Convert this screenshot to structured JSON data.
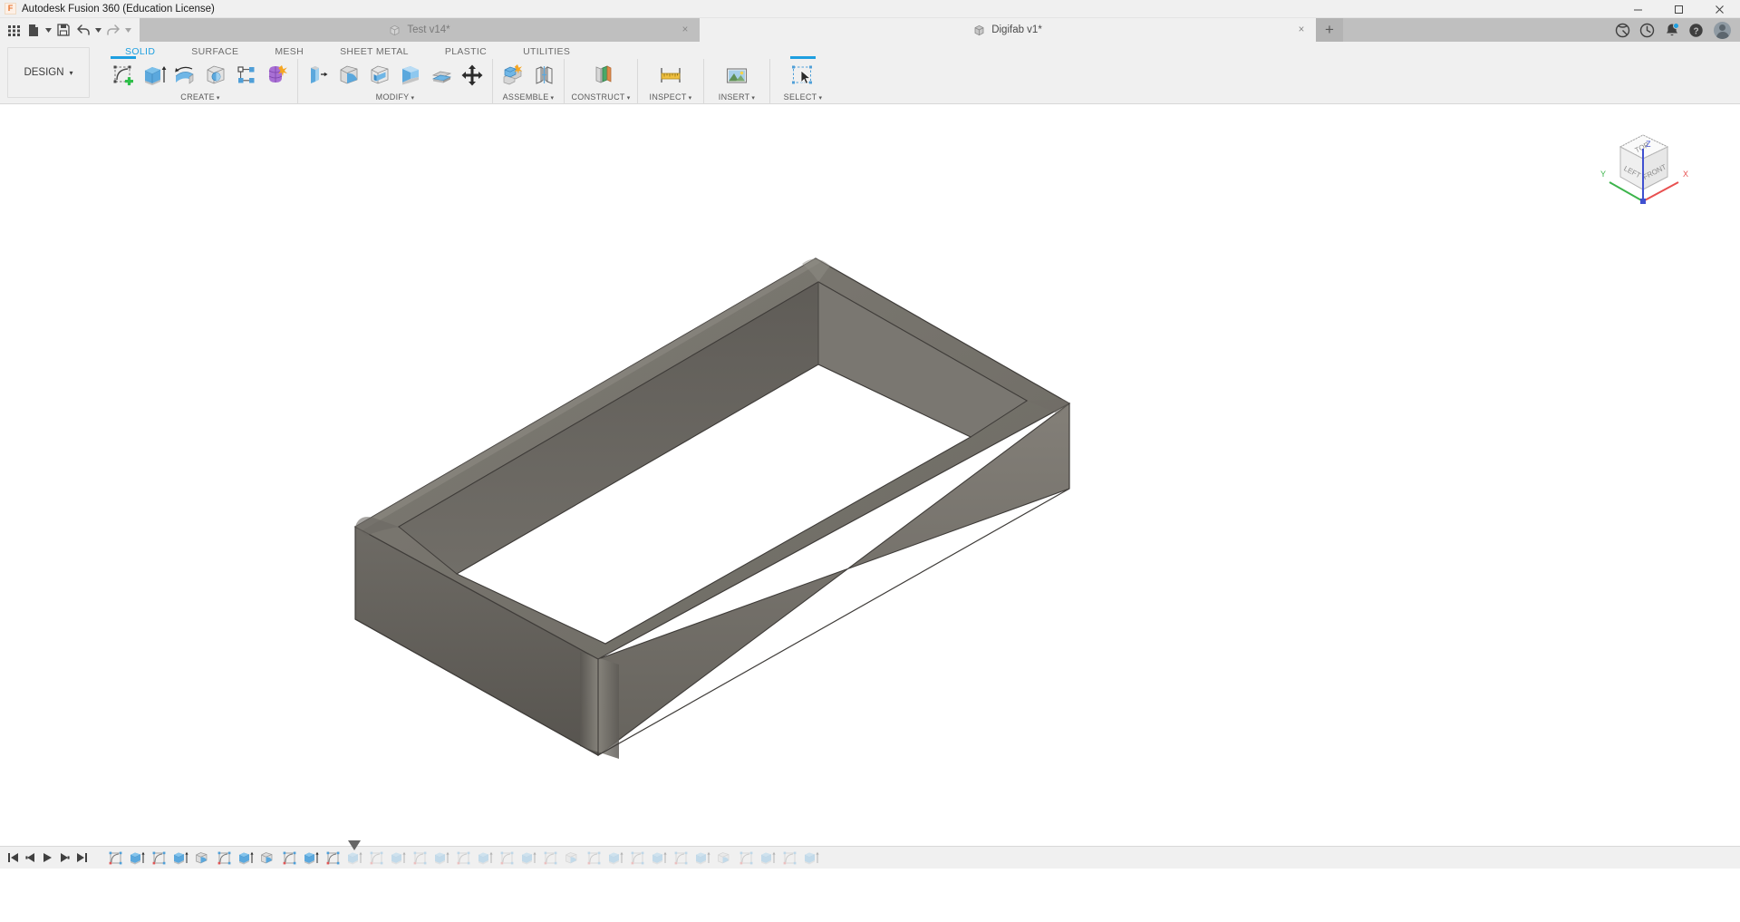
{
  "window": {
    "title": "Autodesk Fusion 360 (Education License)",
    "app_icon": "F",
    "minimize": "minimize-icon",
    "maximize": "maximize-icon",
    "close": "close-icon"
  },
  "quick_access": {
    "grid_label": "app-grid-icon",
    "new_label": "new-document-icon",
    "save_label": "save-icon",
    "undo_label": "undo-icon",
    "redo_label": "redo-icon"
  },
  "document_tabs": [
    {
      "label": "Test v14*",
      "active": false,
      "close": "×"
    },
    {
      "label": "Digifab v1*",
      "active": true,
      "close": "×"
    }
  ],
  "tab_add": "+",
  "tab_right_icons": [
    {
      "name": "data-panel-icon"
    },
    {
      "name": "job-status-icon"
    },
    {
      "name": "notifications-icon",
      "badge": true
    },
    {
      "name": "help-icon"
    },
    {
      "name": "user-avatar"
    }
  ],
  "ribbon": {
    "workspace_selector": "DESIGN",
    "workspace_caret": "▾",
    "tabs": [
      {
        "label": "SOLID",
        "active": true
      },
      {
        "label": "SURFACE",
        "active": false
      },
      {
        "label": "MESH",
        "active": false
      },
      {
        "label": "SHEET METAL",
        "active": false
      },
      {
        "label": "PLASTIC",
        "active": false
      },
      {
        "label": "UTILITIES",
        "active": false
      }
    ],
    "groups": [
      {
        "label": "CREATE",
        "caret": "▾",
        "tools": [
          {
            "name": "create-sketch",
            "selected": true
          },
          {
            "name": "extrude"
          },
          {
            "name": "revolve"
          },
          {
            "name": "sphere"
          },
          {
            "name": "pattern"
          },
          {
            "name": "form"
          }
        ]
      },
      {
        "label": "MODIFY",
        "caret": "▾",
        "tools": [
          {
            "name": "press-pull"
          },
          {
            "name": "fillet"
          },
          {
            "name": "shell"
          },
          {
            "name": "draft"
          },
          {
            "name": "offset-face"
          },
          {
            "name": "move-copy"
          }
        ]
      },
      {
        "label": "ASSEMBLE",
        "caret": "▾",
        "tools": [
          {
            "name": "new-component"
          },
          {
            "name": "joint"
          }
        ]
      },
      {
        "label": "CONSTRUCT",
        "caret": "▾",
        "tools": [
          {
            "name": "offset-plane"
          }
        ]
      },
      {
        "label": "INSPECT",
        "caret": "▾",
        "tools": [
          {
            "name": "measure"
          }
        ]
      },
      {
        "label": "INSERT",
        "caret": "▾",
        "tools": [
          {
            "name": "insert-canvas"
          }
        ]
      },
      {
        "label": "SELECT",
        "caret": "▾",
        "tools": [
          {
            "name": "select-cursor",
            "selected": true
          }
        ]
      }
    ]
  },
  "canvas": {
    "background_color": "#ffffff",
    "model_name": "rectangular-hollow-frame",
    "model_colors": {
      "top_face": "#73706a",
      "outer_side_light": "#7d7a73",
      "outer_side_dark": "#5d5a55",
      "inner_face": "#6a6762",
      "edge": "#4a4744"
    },
    "viewcube": {
      "faces": [
        "TOP",
        "LEFT",
        "FRONT"
      ],
      "axes": [
        {
          "label": "X",
          "color": "#e85050"
        },
        {
          "label": "Y",
          "color": "#3cb44b"
        },
        {
          "label": "Z",
          "color": "#4050d0"
        }
      ]
    }
  },
  "timeline": {
    "playback": [
      {
        "name": "skip-to-start-button",
        "glyph": "jump-start"
      },
      {
        "name": "step-backward-button",
        "glyph": "step-back"
      },
      {
        "name": "play-backward-button",
        "glyph": "play-back"
      },
      {
        "name": "step-forward-button",
        "glyph": "step-fwd"
      },
      {
        "name": "skip-to-end-button",
        "glyph": "jump-end"
      }
    ],
    "features": [
      {
        "name": "sketch",
        "type": "sketch",
        "future": false
      },
      {
        "name": "extrude",
        "type": "extrude",
        "future": false
      },
      {
        "name": "sketch",
        "type": "sketch",
        "future": false
      },
      {
        "name": "extrude",
        "type": "extrude",
        "future": false
      },
      {
        "name": "fillet",
        "type": "fillet",
        "future": false
      },
      {
        "name": "sketch",
        "type": "sketch",
        "future": false
      },
      {
        "name": "extrude",
        "type": "extrude",
        "future": false
      },
      {
        "name": "fillet",
        "type": "fillet",
        "future": false
      },
      {
        "name": "sketch",
        "type": "sketch",
        "future": false
      },
      {
        "name": "extrude",
        "type": "extrude",
        "future": false
      },
      {
        "name": "sketch",
        "type": "sketch",
        "future": false
      },
      {
        "name": "extrude",
        "type": "extrude",
        "future": true
      },
      {
        "name": "sketch",
        "type": "sketch",
        "future": true
      },
      {
        "name": "extrude",
        "type": "extrude",
        "future": true
      },
      {
        "name": "sketch",
        "type": "sketch",
        "future": true
      },
      {
        "name": "extrude",
        "type": "extrude",
        "future": true
      },
      {
        "name": "sketch",
        "type": "sketch",
        "future": true
      },
      {
        "name": "extrude",
        "type": "extrude",
        "future": true
      },
      {
        "name": "sketch",
        "type": "sketch",
        "future": true
      },
      {
        "name": "extrude",
        "type": "extrude",
        "future": true
      },
      {
        "name": "sketch",
        "type": "sketch",
        "future": true
      },
      {
        "name": "fillet",
        "type": "fillet",
        "future": true
      },
      {
        "name": "sketch",
        "type": "sketch",
        "future": true
      },
      {
        "name": "extrude",
        "type": "extrude",
        "future": true
      },
      {
        "name": "sketch",
        "type": "sketch",
        "future": true
      },
      {
        "name": "extrude",
        "type": "extrude",
        "future": true
      },
      {
        "name": "sketch",
        "type": "sketch",
        "future": true
      },
      {
        "name": "extrude",
        "type": "extrude",
        "future": true
      },
      {
        "name": "fillet",
        "type": "fillet",
        "future": true
      },
      {
        "name": "sketch",
        "type": "sketch",
        "future": true
      },
      {
        "name": "extrude",
        "type": "extrude",
        "future": true
      },
      {
        "name": "sketch",
        "type": "sketch",
        "future": true
      },
      {
        "name": "extrude",
        "type": "extrude",
        "future": true
      }
    ],
    "playhead_index": 11
  }
}
